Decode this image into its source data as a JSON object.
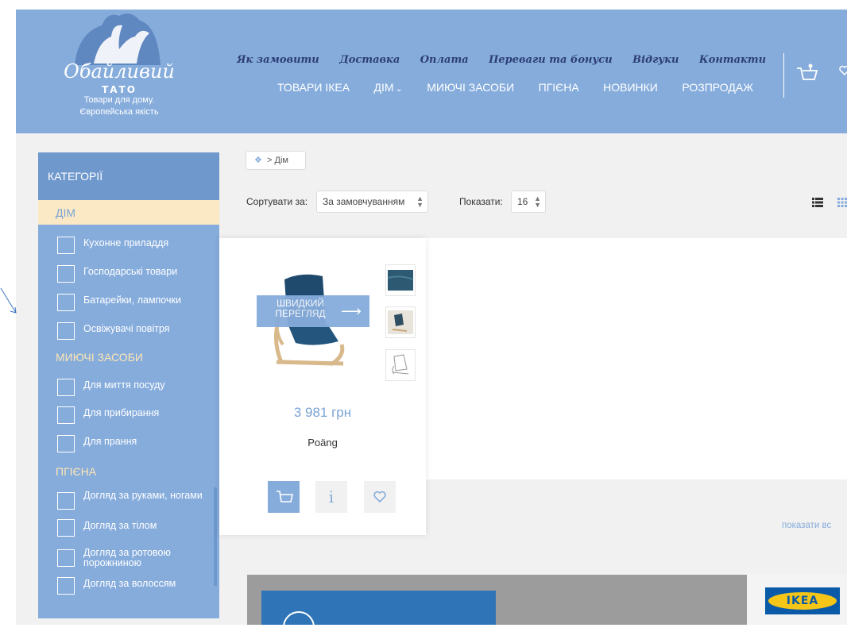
{
  "logo": {
    "script_text": "Обайливий",
    "brand": "ТАТО",
    "tagline_1": "Товари для дому.",
    "tagline_2": "Європейська якість"
  },
  "top_nav": [
    "Як замовити",
    "Доставка",
    "Оплата",
    "Переваги та бонуси",
    "Відгуки",
    "Контакти"
  ],
  "main_nav": [
    "ТОВАРИ ІКЕА",
    "ДІМ",
    "МИЮЧІ ЗАСОБИ",
    "ПГІЄНА",
    "НОВИНКИ",
    "РОЗПРОДАЖ"
  ],
  "header_icons": [
    "cart-icon",
    "heart-icon"
  ],
  "sidebar": {
    "title": "КАТЕГОРІЇ",
    "active": "ДІМ",
    "groups": [
      {
        "items": [
          "Кухонне приладдя",
          "Господарські товари",
          "Батарейки, лампочки",
          "Освіжувачі повітря"
        ]
      },
      {
        "label": "МИЮЧІ ЗАСОБИ",
        "items": [
          "Для миття посуду",
          "Для прибирання",
          "Для прання"
        ]
      },
      {
        "label": "ПГІЄНА",
        "items": [
          "Догляд за руками, ногами",
          "Догляд за тілом",
          "Догляд за ротовою порожниною",
          "Догляд за волоссям"
        ]
      }
    ]
  },
  "breadcrumb": {
    "home_icon": "home-icon",
    "separator": ">",
    "current": "Дім"
  },
  "sort": {
    "label": "Сортувати за:",
    "value": "За замовчуванням"
  },
  "show": {
    "label": "Показати:",
    "value": "16"
  },
  "view_icons": [
    "list-view-icon",
    "grid-view-icon"
  ],
  "product": {
    "quick_view": "ШВИДКИЙ ПЕРЕГЛЯД",
    "price": "3 981 грн",
    "name": "Poäng",
    "buttons": [
      "cart-icon",
      "info-icon",
      "heart-icon"
    ]
  },
  "show_all": "показати вс",
  "banner": {
    "brand": "IKEA"
  },
  "colors": {
    "header": "#86acdc",
    "sidebar_title": "#6f98cd",
    "active_category": "#fbe9c6",
    "nav_script": "#2c3e75",
    "price": "#7aa3d6",
    "section": "#fde6b2"
  }
}
